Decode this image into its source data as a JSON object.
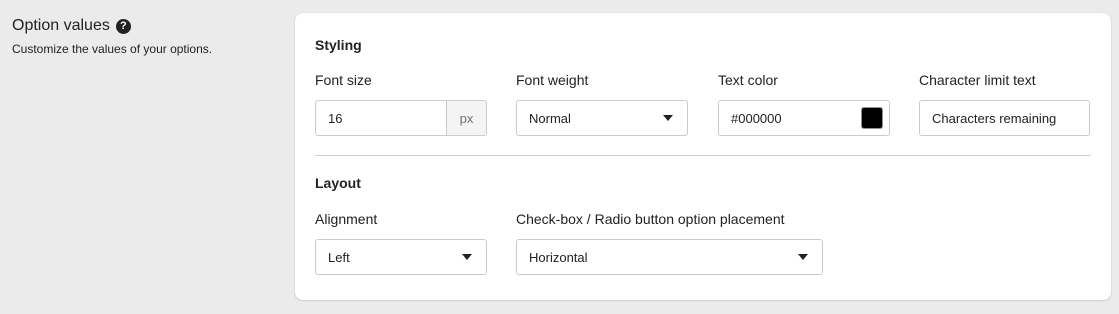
{
  "section": {
    "title": "Option values",
    "description": "Customize the values of your options."
  },
  "styling": {
    "heading": "Styling",
    "font_size": {
      "label": "Font size",
      "value": "16",
      "suffix": "px"
    },
    "font_weight": {
      "label": "Font weight",
      "value": "Normal"
    },
    "text_color": {
      "label": "Text color",
      "value": "#000000",
      "swatch_color": "#000000"
    },
    "char_limit": {
      "label": "Character limit text",
      "value": "Characters remaining"
    }
  },
  "layout": {
    "heading": "Layout",
    "alignment": {
      "label": "Alignment",
      "value": "Left"
    },
    "placement": {
      "label": "Check-box / Radio button option placement",
      "value": "Horizontal"
    }
  },
  "icons": {
    "help": "question-circle-icon",
    "caret": "chevron-down-icon"
  }
}
